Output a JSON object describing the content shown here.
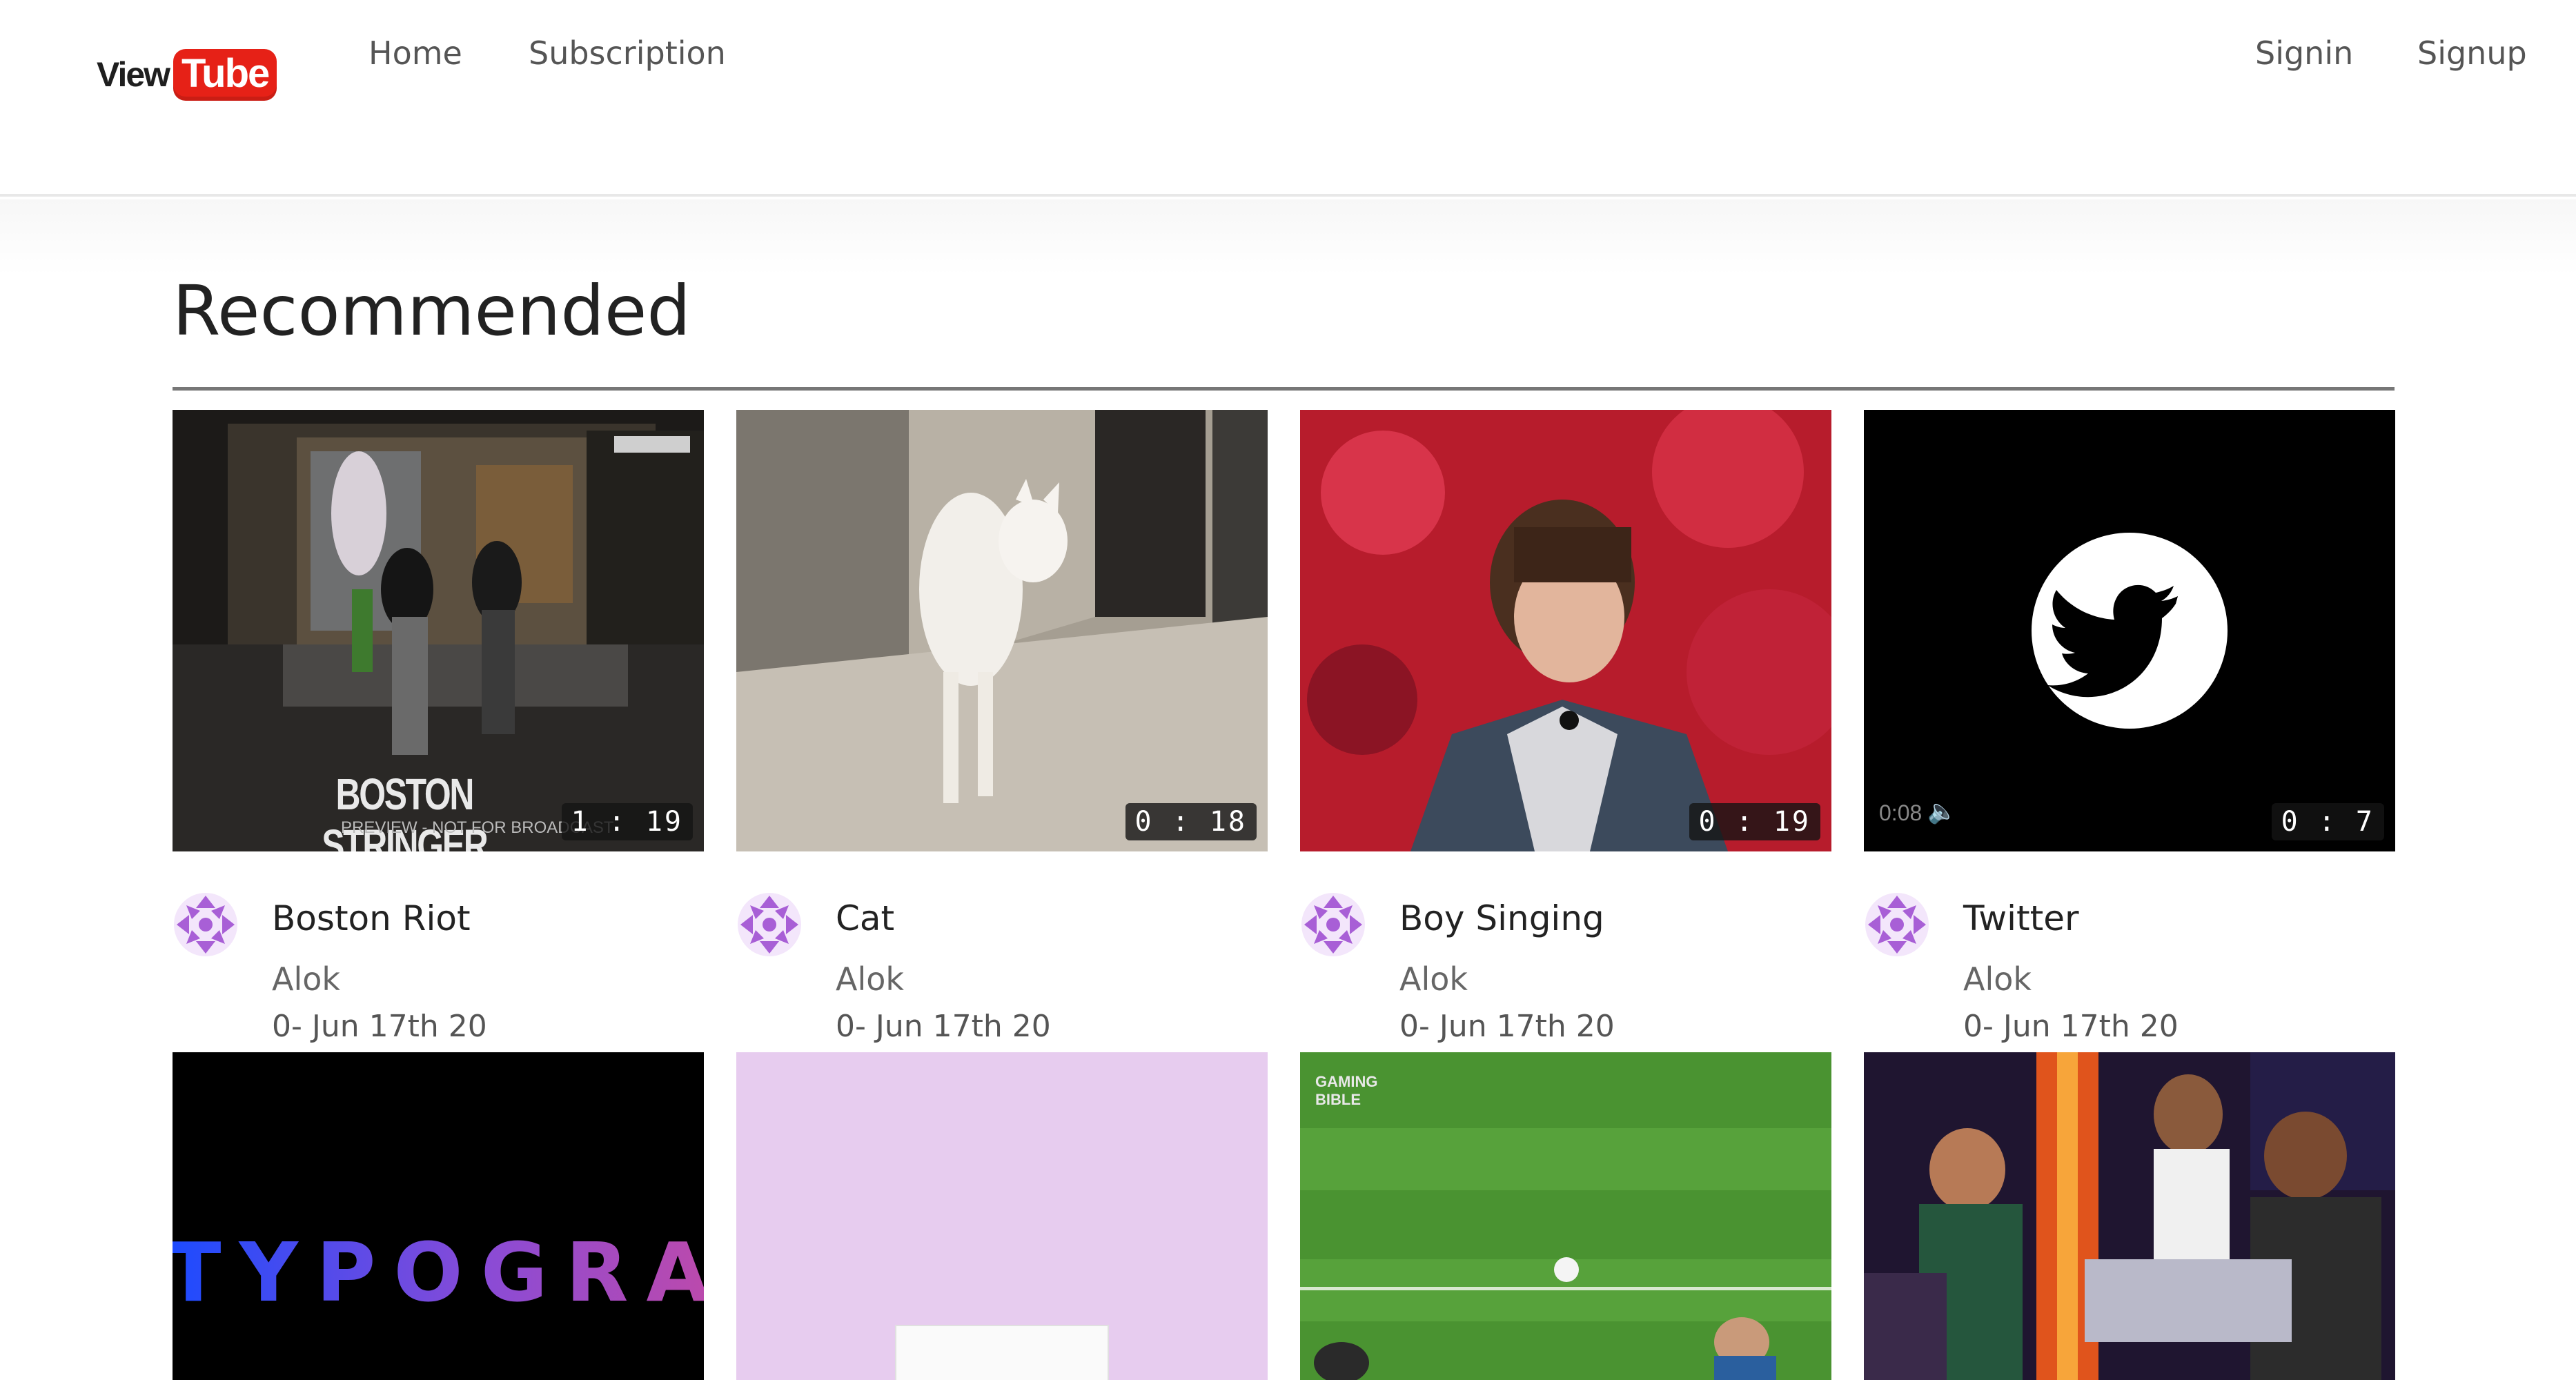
{
  "brand": {
    "view": "View",
    "tube": "Tube"
  },
  "nav": {
    "home": "Home",
    "subscription": "Subscription",
    "signin": "Signin",
    "signup": "Signup"
  },
  "section_title": "Recommended",
  "colors": {
    "logo_red": "#e62117",
    "avatar_purple": "#a85fd6"
  },
  "videos": [
    {
      "title": "Boston Riot",
      "channel": "Alok",
      "date": "0- Jun 17th 20",
      "duration": "1 : 19",
      "overlay_text": "BOSTON STRINGER MEDIA",
      "overlay_sub": "PREVIEW - NOT FOR BROADCAST"
    },
    {
      "title": "Cat",
      "channel": "Alok",
      "date": "0- Jun 17th 20",
      "duration": "0 : 18"
    },
    {
      "title": "Boy Singing",
      "channel": "Alok",
      "date": "0- Jun 17th 20",
      "duration": "0 : 19"
    },
    {
      "title": "Twitter",
      "channel": "Alok",
      "date": "0- Jun 17th 20",
      "duration": "0 : 7",
      "player_time": "0:08"
    }
  ],
  "row2": [
    {
      "overlay_text": "TYPOGRAP"
    },
    {
      "overlay_text": ""
    },
    {
      "overlay_text": "GAMING BIBLE"
    },
    {
      "overlay_text": ""
    }
  ]
}
